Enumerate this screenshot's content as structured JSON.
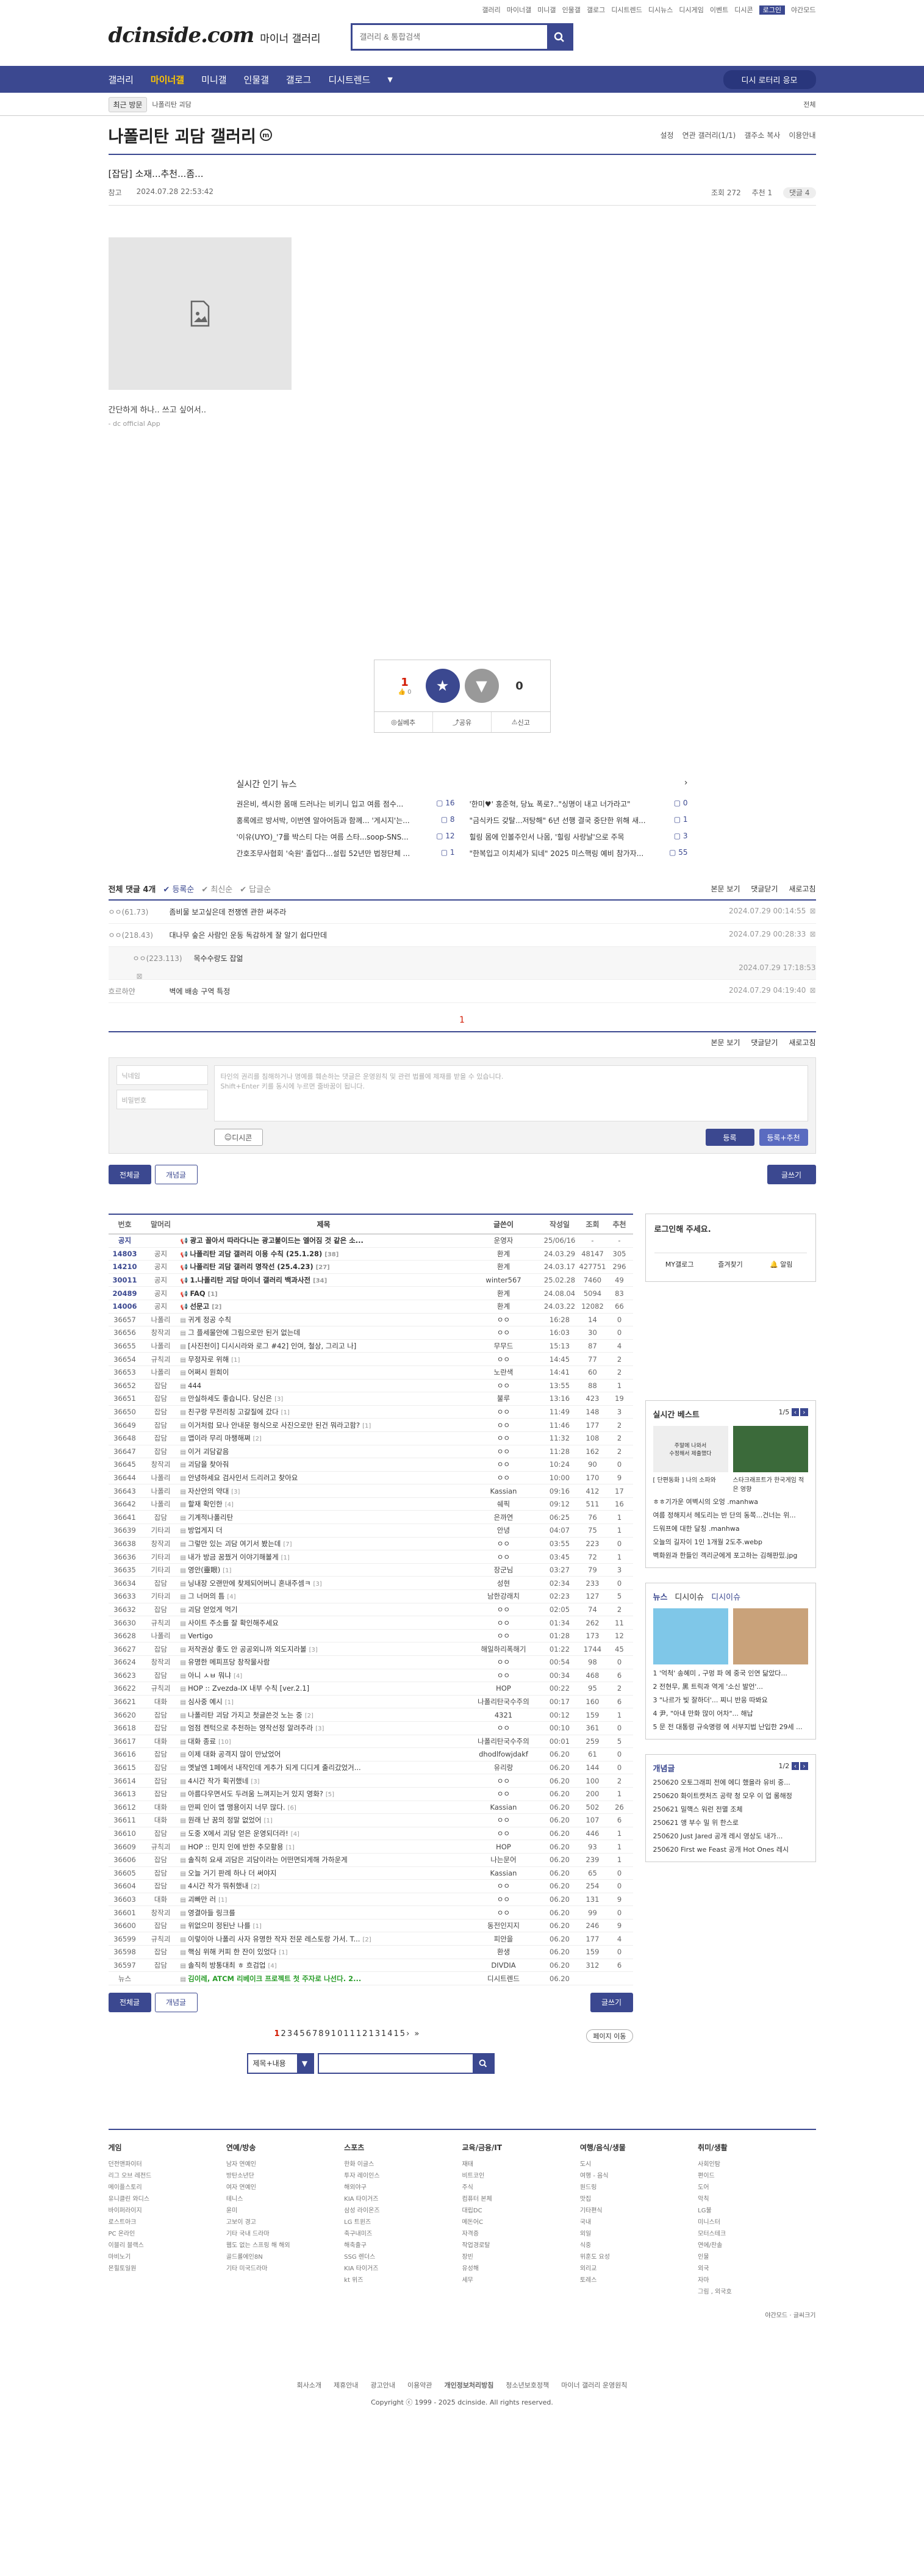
{
  "util_links": [
    "갤러리",
    "마이너갤",
    "미니갤",
    "인물갤",
    "갤로그",
    "디시트렌드",
    "디시뉴스",
    "디시게임",
    "이벤트",
    "디시콘",
    "로그인",
    "야간모드"
  ],
  "logo": "dcinside.com",
  "logo_sub": "마이너 갤러리",
  "search_placeholder": "갤러리 & 통합검색",
  "gnb": [
    "갤러리",
    "마이너갤",
    "미니갤",
    "인물갤",
    "갤로그",
    "디시트렌드"
  ],
  "gnb_minor_button": "디시 로터리 응모",
  "subbar": {
    "chip1": "최근 방문",
    "chip2": "나폴리탄 괴담",
    "link": "전체"
  },
  "gallery_title": "나폴리탄 괴담 갤러리",
  "gallery_badge": "m",
  "title_links": [
    "설정",
    "연관 갤러리(1/1)",
    "갤주소 복사",
    "이용안내"
  ],
  "post": {
    "title": "[잡담] 소재...추천...좀...",
    "writer": "참고",
    "date": "2024.07.28 22:53:42",
    "views": "조회 272",
    "recommend": "추천 1",
    "comments_badge": "댓글 4",
    "caption": "간단하게 하나.. 쓰고 싶어서..",
    "caption2": "- dc official App"
  },
  "vote": {
    "up_count": "1",
    "up_sub": "0",
    "up_label": "개념",
    "down_label": "비추",
    "down_count": "0",
    "share": "실베추",
    "copy": "공유",
    "report": "신고"
  },
  "news": {
    "title": "실시간 인기 뉴스",
    "items": [
      {
        "t": "권은비, 섹시한 몸매 드러나는 비키니 입고 여름 점수...",
        "c": "16"
      },
      {
        "t": "'한미♥' 홍준혁, 당뇨 폭로?..\"싱명이 내고 너가라고\"",
        "c": "0"
      },
      {
        "t": "홍록에르 방서박, 이번엔 알아어듬과 함께... '게시지'는...",
        "c": "8"
      },
      {
        "t": "\"금식카드 갖탈...저탕해\" 6년 선행 결국 중단한 위해 새...",
        "c": "1"
      },
      {
        "t": "'이유(UYO)_'7를 박스티 다는 여름 스타...soop-SNS...",
        "c": "12"
      },
      {
        "t": "힐링 몸에 인볼주인서 나몸, '힐링 사랑날'으로 주목",
        "c": "3"
      },
      {
        "t": "간호조무사협회 '숙원' 졸업다...설립 52년만 법정단체 ...",
        "c": "1"
      },
      {
        "t": "\"한복입고 이치세가 되네\" 2025 미스핵링 예비 참가자...",
        "c": "55"
      }
    ]
  },
  "comments": {
    "total": "전체 댓글 4개",
    "tabs": [
      "등록순",
      "최신순",
      "답글순"
    ],
    "right": [
      "본문 보기",
      "댓글닫기",
      "새로고침"
    ],
    "items": [
      {
        "nick": "ㅇㅇ(61.73)",
        "text": "좀비물 보고싶은데 전쟁엔 관한 써주라",
        "date": "2024.07.29 00:14:55",
        "reply": false
      },
      {
        "nick": "ㅇㅇ(218.43)",
        "text": "대나무 숲은 사람인 운동 독감하게 잘 알기 쉽다만데",
        "date": "2024.07.29 00:28:33",
        "reply": false
      },
      {
        "nick": "ㅇㅇ(223.113)",
        "text": "목수수랑도 잡얾",
        "date": "2024.07.29 17:18:53",
        "reply": true
      },
      {
        "nick": "흐르하얀",
        "text": "벽에 배송 구역 특정",
        "date": "2024.07.29 04:19:40",
        "reply": false
      }
    ],
    "page": "1",
    "form": {
      "nick": "닉네임",
      "pw": "비밀번호",
      "ta": "타인의 권리를 침해하거나 명예를 훼손하는 댓글은 운영원칙 및 관련 법률에 제재를 받을 수 있습니다.\nShift+Enter 키를 동시에 누르면 줄바꿈이 됩니다.",
      "dccon": "디시콘",
      "submit": "등록",
      "submit2": "등록+추천"
    }
  },
  "list_buttons": {
    "all": "전체글",
    "concept": "개념글",
    "write": "글쓰기"
  },
  "list_head": {
    "no": "번호",
    "head": "말머리",
    "title": "제목",
    "writer": "글쓴이",
    "date": "작성일",
    "views": "조회",
    "rec": "추천"
  },
  "rows": [
    {
      "no": "공지",
      "hd": "",
      "t": "광고 꼴아서 따라다니는 광고불이드는 엘어짐 것 같은 소...",
      "cc": "",
      "w": "운영자",
      "d": "25/06/16",
      "v": "-",
      "r": "-",
      "n": true
    },
    {
      "no": "14803",
      "hd": "공지",
      "t": "나폴리탄 괴담 갤러리 이용 수칙 (25.1.28)",
      "cc": "[38]",
      "w": "환계",
      "d": "24.03.29",
      "v": "48147",
      "r": "305",
      "n": true
    },
    {
      "no": "14210",
      "hd": "공지",
      "t": "나폴리탄 괴담 갤러리 명작선 (25.4.23)",
      "cc": "[27]",
      "w": "환계",
      "d": "24.03.17",
      "v": "427751",
      "r": "296",
      "n": true
    },
    {
      "no": "30011",
      "hd": "공지",
      "t": "1.나폴리탄 괴담 마이너 갤러리 백과사전",
      "cc": "[34]",
      "w": "winter567",
      "d": "25.02.28",
      "v": "7460",
      "r": "49",
      "n": true
    },
    {
      "no": "20489",
      "hd": "공지",
      "t": "FAQ",
      "cc": "[1]",
      "w": "환계",
      "d": "24.08.04",
      "v": "5094",
      "r": "83",
      "n": true
    },
    {
      "no": "14006",
      "hd": "공지",
      "t": "선문고",
      "cc": "[2]",
      "w": "환계",
      "d": "24.03.22",
      "v": "12082",
      "r": "66",
      "n": true
    },
    {
      "no": "36657",
      "hd": "나폴리",
      "t": "귀게 정공 수칙",
      "cc": "",
      "w": "ㅇㅇ",
      "d": "16:28",
      "v": "14",
      "r": "0",
      "n": false
    },
    {
      "no": "36656",
      "hd": "창작괴",
      "t": "그 플세물안에 그림으로만 된거 없는데",
      "cc": "",
      "w": "ㅇㅇ",
      "d": "16:03",
      "v": "30",
      "r": "0",
      "n": false
    },
    {
      "no": "36655",
      "hd": "나폴리",
      "t": "[사진천이] 디시시라와 로그 #42] 인여, 철상, 그리고 나]",
      "cc": "",
      "w": "무무드",
      "d": "15:13",
      "v": "87",
      "r": "4",
      "n": false
    },
    {
      "no": "36654",
      "hd": "규칙괴",
      "t": "무정자로 위해",
      "cc": "[1]",
      "w": "ㅇㅇ",
      "d": "14:45",
      "v": "77",
      "r": "2",
      "n": false
    },
    {
      "no": "36653",
      "hd": "나폴리",
      "t": "어쩌시 원희이",
      "cc": "",
      "w": "노란색",
      "d": "14:41",
      "v": "60",
      "r": "2",
      "n": false
    },
    {
      "no": "36652",
      "hd": "잡담",
      "t": "444",
      "cc": "",
      "w": "ㅇㅇ",
      "d": "13:55",
      "v": "88",
      "r": "1",
      "n": false
    },
    {
      "no": "36651",
      "hd": "잡담",
      "t": "만실하세도 좋습니다. 당신은",
      "cc": "[3]",
      "w": "불루",
      "d": "13:16",
      "v": "423",
      "r": "19",
      "n": false
    },
    {
      "no": "36650",
      "hd": "잡담",
      "t": "친구랑 무전리칭 고갈질에 갔다",
      "cc": "[1]",
      "w": "ㅇㅇ",
      "d": "11:49",
      "v": "148",
      "r": "3",
      "n": false
    },
    {
      "no": "36649",
      "hd": "잡담",
      "t": "이거처럼 묘나 안내문 형식으로 사진으로만 된건 뭐라고함?",
      "cc": "[1]",
      "w": "ㅇㅇ",
      "d": "11:46",
      "v": "177",
      "r": "2",
      "n": false
    },
    {
      "no": "36648",
      "hd": "잡담",
      "t": "앱이라 무리 마챙해쪄",
      "cc": "[2]",
      "w": "ㅇㅇ",
      "d": "11:32",
      "v": "108",
      "r": "2",
      "n": false
    },
    {
      "no": "36647",
      "hd": "잡담",
      "t": "이거 괴담같음",
      "cc": "",
      "w": "ㅇㅇ",
      "d": "11:28",
      "v": "162",
      "r": "2",
      "n": false
    },
    {
      "no": "36645",
      "hd": "창작괴",
      "t": "괴담을 찾아줘",
      "cc": "",
      "w": "ㅇㅇ",
      "d": "10:24",
      "v": "90",
      "r": "0",
      "n": false
    },
    {
      "no": "36644",
      "hd": "나폴리",
      "t": "안녕하세요 검사인서 드리러고 찾아요",
      "cc": "",
      "w": "ㅇㅇ",
      "d": "10:00",
      "v": "170",
      "r": "9",
      "n": false
    },
    {
      "no": "36643",
      "hd": "나폴리",
      "t": "자산안의 약대",
      "cc": "[3]",
      "w": "Kassian",
      "d": "09:16",
      "v": "412",
      "r": "17",
      "n": false
    },
    {
      "no": "36642",
      "hd": "나폴리",
      "t": "할재 확인한",
      "cc": "[4]",
      "w": "쉐픽",
      "d": "09:12",
      "v": "511",
      "r": "16",
      "n": false
    },
    {
      "no": "36641",
      "hd": "잡담",
      "t": "기계적나폴리탄",
      "cc": "",
      "w": "은까연",
      "d": "06:25",
      "v": "76",
      "r": "1",
      "n": false
    },
    {
      "no": "36639",
      "hd": "기타괴",
      "t": "방업게지 더",
      "cc": "",
      "w": "안녕",
      "d": "04:07",
      "v": "75",
      "r": "1",
      "n": false
    },
    {
      "no": "36638",
      "hd": "창작괴",
      "t": "그렇만 있는 괴담 여기서 봤는데",
      "cc": "[7]",
      "w": "ㅇㅇ",
      "d": "03:55",
      "v": "223",
      "r": "0",
      "n": false
    },
    {
      "no": "36636",
      "hd": "기타괴",
      "t": "내가 방금 꿈꿨거 이야기해볼게",
      "cc": "[1]",
      "w": "ㅇㅇ",
      "d": "03:45",
      "v": "72",
      "r": "1",
      "n": false
    },
    {
      "no": "36635",
      "hd": "기타괴",
      "t": "영안(靈眼)",
      "cc": "[1]",
      "w": "장군님",
      "d": "03:27",
      "v": "79",
      "r": "3",
      "n": false
    },
    {
      "no": "36634",
      "hd": "잡담",
      "t": "닝내장 오랜만에 찾제되어버니 혼내주셈ㅋ",
      "cc": "[3]",
      "w": "성현",
      "d": "02:34",
      "v": "233",
      "r": "0",
      "n": false
    },
    {
      "no": "36633",
      "hd": "기타괴",
      "t": "그 너머의 틈",
      "cc": "[4]",
      "w": "남한강래치",
      "d": "02:23",
      "v": "127",
      "r": "5",
      "n": false
    },
    {
      "no": "36632",
      "hd": "잡담",
      "t": "괴담 얻었게 먹기",
      "cc": "",
      "w": "ㅇㅇ",
      "d": "02:05",
      "v": "74",
      "r": "2",
      "n": false
    },
    {
      "no": "36630",
      "hd": "규칙괴",
      "t": "사이트 주소를 잘 확인해주세요",
      "cc": "",
      "w": "ㅇㅇ",
      "d": "01:34",
      "v": "262",
      "r": "11",
      "n": false
    },
    {
      "no": "36628",
      "hd": "나폴리",
      "t": "Vertigo",
      "cc": "",
      "w": "ㅇㅇ",
      "d": "01:28",
      "v": "173",
      "r": "12",
      "n": false
    },
    {
      "no": "36627",
      "hd": "잡담",
      "t": "저작권상 좋도 안 공공외니까 외도지라볼",
      "cc": "[3]",
      "w": "해일하리폭해기",
      "d": "01:22",
      "v": "1744",
      "r": "45",
      "n": false
    },
    {
      "no": "36624",
      "hd": "창작괴",
      "t": "유명한 메피프당 창작물사람",
      "cc": "",
      "w": "ㅇㅇ",
      "d": "00:54",
      "v": "98",
      "r": "0",
      "n": false
    },
    {
      "no": "36623",
      "hd": "잡담",
      "t": "아니 ㅅㅂ 뭐냐",
      "cc": "[4]",
      "w": "ㅇㅇ",
      "d": "00:34",
      "v": "468",
      "r": "6",
      "n": false
    },
    {
      "no": "36622",
      "hd": "규칙괴",
      "t": "HOP :: Zvezda-IX 내부 수칙 [ver.2.1]",
      "cc": "",
      "w": "HOP",
      "d": "00:22",
      "v": "95",
      "r": "2",
      "n": false
    },
    {
      "no": "36621",
      "hd": "대화",
      "t": "심사중 예시",
      "cc": "[1]",
      "w": "나폴리탄국수주의",
      "d": "00:17",
      "v": "160",
      "r": "6",
      "n": false
    },
    {
      "no": "36620",
      "hd": "잡담",
      "t": "나폴리탄 괴담 가지고 첫글쓴것 노는 중",
      "cc": "[2]",
      "w": "4321",
      "d": "00:12",
      "v": "159",
      "r": "1",
      "n": false
    },
    {
      "no": "36618",
      "hd": "잡담",
      "t": "엄점 켄턱으로 추천하는 영작선정 알려주라",
      "cc": "[3]",
      "w": "ㅇㅇ",
      "d": "00:10",
      "v": "361",
      "r": "0",
      "n": false
    },
    {
      "no": "36617",
      "hd": "대화",
      "t": "대화 종료",
      "cc": "[10]",
      "w": "나폴리탄국수주의",
      "d": "00:01",
      "v": "259",
      "r": "5",
      "n": false
    },
    {
      "no": "36616",
      "hd": "잡담",
      "t": "이제 대화 공격지 많이 만났었어",
      "cc": "",
      "w": "dhodlfowjdakf",
      "d": "06.20",
      "v": "61",
      "r": "0",
      "n": false
    },
    {
      "no": "36615",
      "hd": "잡담",
      "t": "옛날엔 1페에서 내작인데 게추가 되게 디디게 출리갔었거...",
      "cc": "",
      "w": "유리랑",
      "d": "06.20",
      "v": "144",
      "r": "0",
      "n": false
    },
    {
      "no": "36614",
      "hd": "잡담",
      "t": "4시간 작가 획귀했네",
      "cc": "[3]",
      "w": "ㅇㅇ",
      "d": "06.20",
      "v": "100",
      "r": "2",
      "n": false
    },
    {
      "no": "36613",
      "hd": "잡담",
      "t": "아름다우면서도 두려움 느껴지는거 있지 영화?",
      "cc": "[5]",
      "w": "ㅇㅇ",
      "d": "06.20",
      "v": "200",
      "r": "1",
      "n": false
    },
    {
      "no": "36612",
      "hd": "대화",
      "t": "만찌 인이 앱 맹용이지 너무 많다.",
      "cc": "[6]",
      "w": "Kassian",
      "d": "06.20",
      "v": "502",
      "r": "26",
      "n": false
    },
    {
      "no": "36611",
      "hd": "대화",
      "t": "원래 난 꿈의 정말 없었어",
      "cc": "[1]",
      "w": "ㅇㅇ",
      "d": "06.20",
      "v": "107",
      "r": "6",
      "n": false
    },
    {
      "no": "36610",
      "hd": "잡담",
      "t": "도중 X에서 괴담 얻은 운영되더라!",
      "cc": "[4]",
      "w": "ㅇㅇ",
      "d": "06.20",
      "v": "446",
      "r": "1",
      "n": false
    },
    {
      "no": "36609",
      "hd": "규칙괴",
      "t": "HOP :: 민치 인에 반한 추모활용",
      "cc": "[1]",
      "w": "HOP",
      "d": "06.20",
      "v": "93",
      "r": "1",
      "n": false
    },
    {
      "no": "36606",
      "hd": "잡담",
      "t": "솔직히 요새 괴담은 괴담이라는 어떤면되게해 가하운게",
      "cc": "",
      "w": "나는문어",
      "d": "06.20",
      "v": "239",
      "r": "1",
      "n": false
    },
    {
      "no": "36605",
      "hd": "잡담",
      "t": "오늘 거기 판례 하나 더 써야지",
      "cc": "",
      "w": "Kassian",
      "d": "06.20",
      "v": "65",
      "r": "0",
      "n": false
    },
    {
      "no": "36604",
      "hd": "잡담",
      "t": "4시간 작가 뭐취했내",
      "cc": "[2]",
      "w": "ㅇㅇ",
      "d": "06.20",
      "v": "254",
      "r": "0",
      "n": false
    },
    {
      "no": "36603",
      "hd": "대화",
      "t": "괴빠만 러",
      "cc": "[1]",
      "w": "ㅇㅇ",
      "d": "06.20",
      "v": "131",
      "r": "9",
      "n": false
    },
    {
      "no": "36601",
      "hd": "창작괴",
      "t": "영결아들 링크를",
      "cc": "",
      "w": "ㅇㅇ",
      "d": "06.20",
      "v": "99",
      "r": "0",
      "n": false
    },
    {
      "no": "36600",
      "hd": "잡담",
      "t": "위없으미 정된난 나를",
      "cc": "[1]",
      "w": "동전인지지",
      "d": "06.20",
      "v": "246",
      "r": "9",
      "n": false
    },
    {
      "no": "36599",
      "hd": "규칙괴",
      "t": "이렇이아 나폴리 사자 유명한 작자 전문 레스토랑 가서. T...",
      "cc": "[2]",
      "w": "피안을",
      "d": "06.20",
      "v": "177",
      "r": "4",
      "n": false
    },
    {
      "no": "36598",
      "hd": "잡담",
      "t": "핵심 위해 커피 한 잔이 있었다",
      "cc": "[1]",
      "w": "환생",
      "d": "06.20",
      "v": "159",
      "r": "0",
      "n": false
    },
    {
      "no": "36597",
      "hd": "잡담",
      "t": "솔직히 방통대최 ㅎ 흐검업",
      "cc": "[4]",
      "w": "DIVDIA",
      "d": "06.20",
      "v": "312",
      "r": "6",
      "n": false
    },
    {
      "no": "뉴스",
      "hd": "",
      "t": "김이레, ATCM 리베이크 프로젝트 첫 주자로 나선다. 2...",
      "cc": "",
      "w": "디시트렌드",
      "d": "06.20",
      "v": "",
      "r": "",
      "n": false
    }
  ],
  "side": {
    "login_title": "로그인해 주세요.",
    "login_btns": [
      "MY갤로그",
      "즐겨찾기",
      "알림"
    ],
    "best_title": "실시간 베스트",
    "best_page": "1/5",
    "best_caps": [
      "[ 단편동화 ] 나의 소파와",
      "스타크래프트가 한국게임 적은 영향"
    ],
    "best_items": [
      "ㅎㅎ기가운 여벽시의 오엉 .manhwa",
      "여름 정해지서 헤도리는 반 단의 동쪽...건너는 위...",
      "드워프에 대한 달칭 .manhwa",
      "오늘의 길자이 1인 1개월 2도추.webp",
      "벽화원과 한들인 객리군에게 포고하는 김해판밌.jpg"
    ],
    "news_tabs": [
      "뉴스",
      "디시이슈",
      "디시이슈"
    ],
    "news_items": [
      "1 '억척' 송혜미 , 구멍 파 에 중국 인연 닮았다...",
      "2 전현무, 黑 트릭과 역게 '소신 발언'...",
      "3 \"나르가 빛 잘하더'... 찌니 반응 따봐요",
      "4 尹, \"아내 만화 많이 어차\"... 해납",
      "5 문 전 대통령 규숙명령 에 서부지법 난입한 29세 ..."
    ],
    "concept_title": "개념글",
    "concept_page": "1/2",
    "concept_items": [
      "250620 오토그래피 전에 에디 했을라 유비 중...",
      "250620 화이트캣처즈 공략 청 모우 이 업 롱해정",
      "250621 밀핵스 워런 전멸 조체",
      "250621 앵 부수 밀 위 한스로",
      "250620 Just Jared 공개 레시 영상도 내가...",
      "250620 First we Feast 공개 Hot Ones 레시"
    ]
  },
  "pager": {
    "pages": [
      "1",
      "2",
      "3",
      "4",
      "5",
      "6",
      "7",
      "8",
      "9",
      "10",
      "11",
      "12",
      "13",
      "14",
      "15"
    ],
    "jump": "페이지 이동"
  },
  "bottom_search": {
    "select": "제목+내용"
  },
  "footer": {
    "cols": [
      {
        "h": "게임",
        "items": [
          "던전앤파이터",
          "리그 오브 레전드",
          "메이플스토리",
          "유니클린 와디스",
          "바이퍼라이지",
          "로스트아크",
          "PC 온라인",
          "이블리 블랙스",
          "마비노기",
          "몬힐토일원"
        ]
      },
      {
        "h": "연예/방송",
        "items": [
          "남자 연예인",
          "방탄소년단",
          "여자 연예인",
          "테니스",
          "윤미",
          "고보이 경고",
          "기타 국내 드라마",
          "웹도 없는 스프링 해 해외",
          "골드롤에인8N",
          "기타 미국드라마"
        ]
      },
      {
        "h": "스포츠",
        "items": [
          "한화 이글스",
          "투자 레이인스",
          "해외야구",
          "KIA 타이거즈",
          "삼성 라이온즈",
          "LG 트윈즈",
          "축구내미즈",
          "해축출구",
          "SSG 렌더스",
          "KIA 타이거즈",
          "kt 위즈"
        ]
      },
      {
        "h": "교육/금융/IT",
        "items": [
          "재태",
          "비트코인",
          "주식",
          "컴퓨터 본체",
          "대립DC",
          "메돈어C",
          "자격증",
          "작업경로탈",
          "장빈",
          "유성해",
          "세무"
        ]
      },
      {
        "h": "여행/음식/생물",
        "items": [
          "도시",
          "여행 - 음식",
          "원드링",
          "맛집",
          "기타편식",
          "국내",
          "외일",
          "식중",
          "위훈도 요성",
          "외리교",
          "토레스"
        ]
      },
      {
        "h": "취미/생활",
        "items": [
          "사회인탐",
          "편이드",
          "도어",
          "악칙",
          "LG불",
          "미니스터",
          "모터스테크",
          "연에/찬솔",
          "인물",
          "외국",
          "자마",
          "그림 , 외국호"
        ]
      }
    ],
    "prefs": [
      "야간모드",
      "글씨크기"
    ],
    "links": [
      "회사소개",
      "제휴안내",
      "광고안내",
      "이용약관",
      "개인정보처리방침",
      "청소년보호정책",
      "마이너 갤러리 운영원칙"
    ],
    "copyright": "Copyright ⓒ 1999 - 2025 dcinside. All rights reserved."
  }
}
